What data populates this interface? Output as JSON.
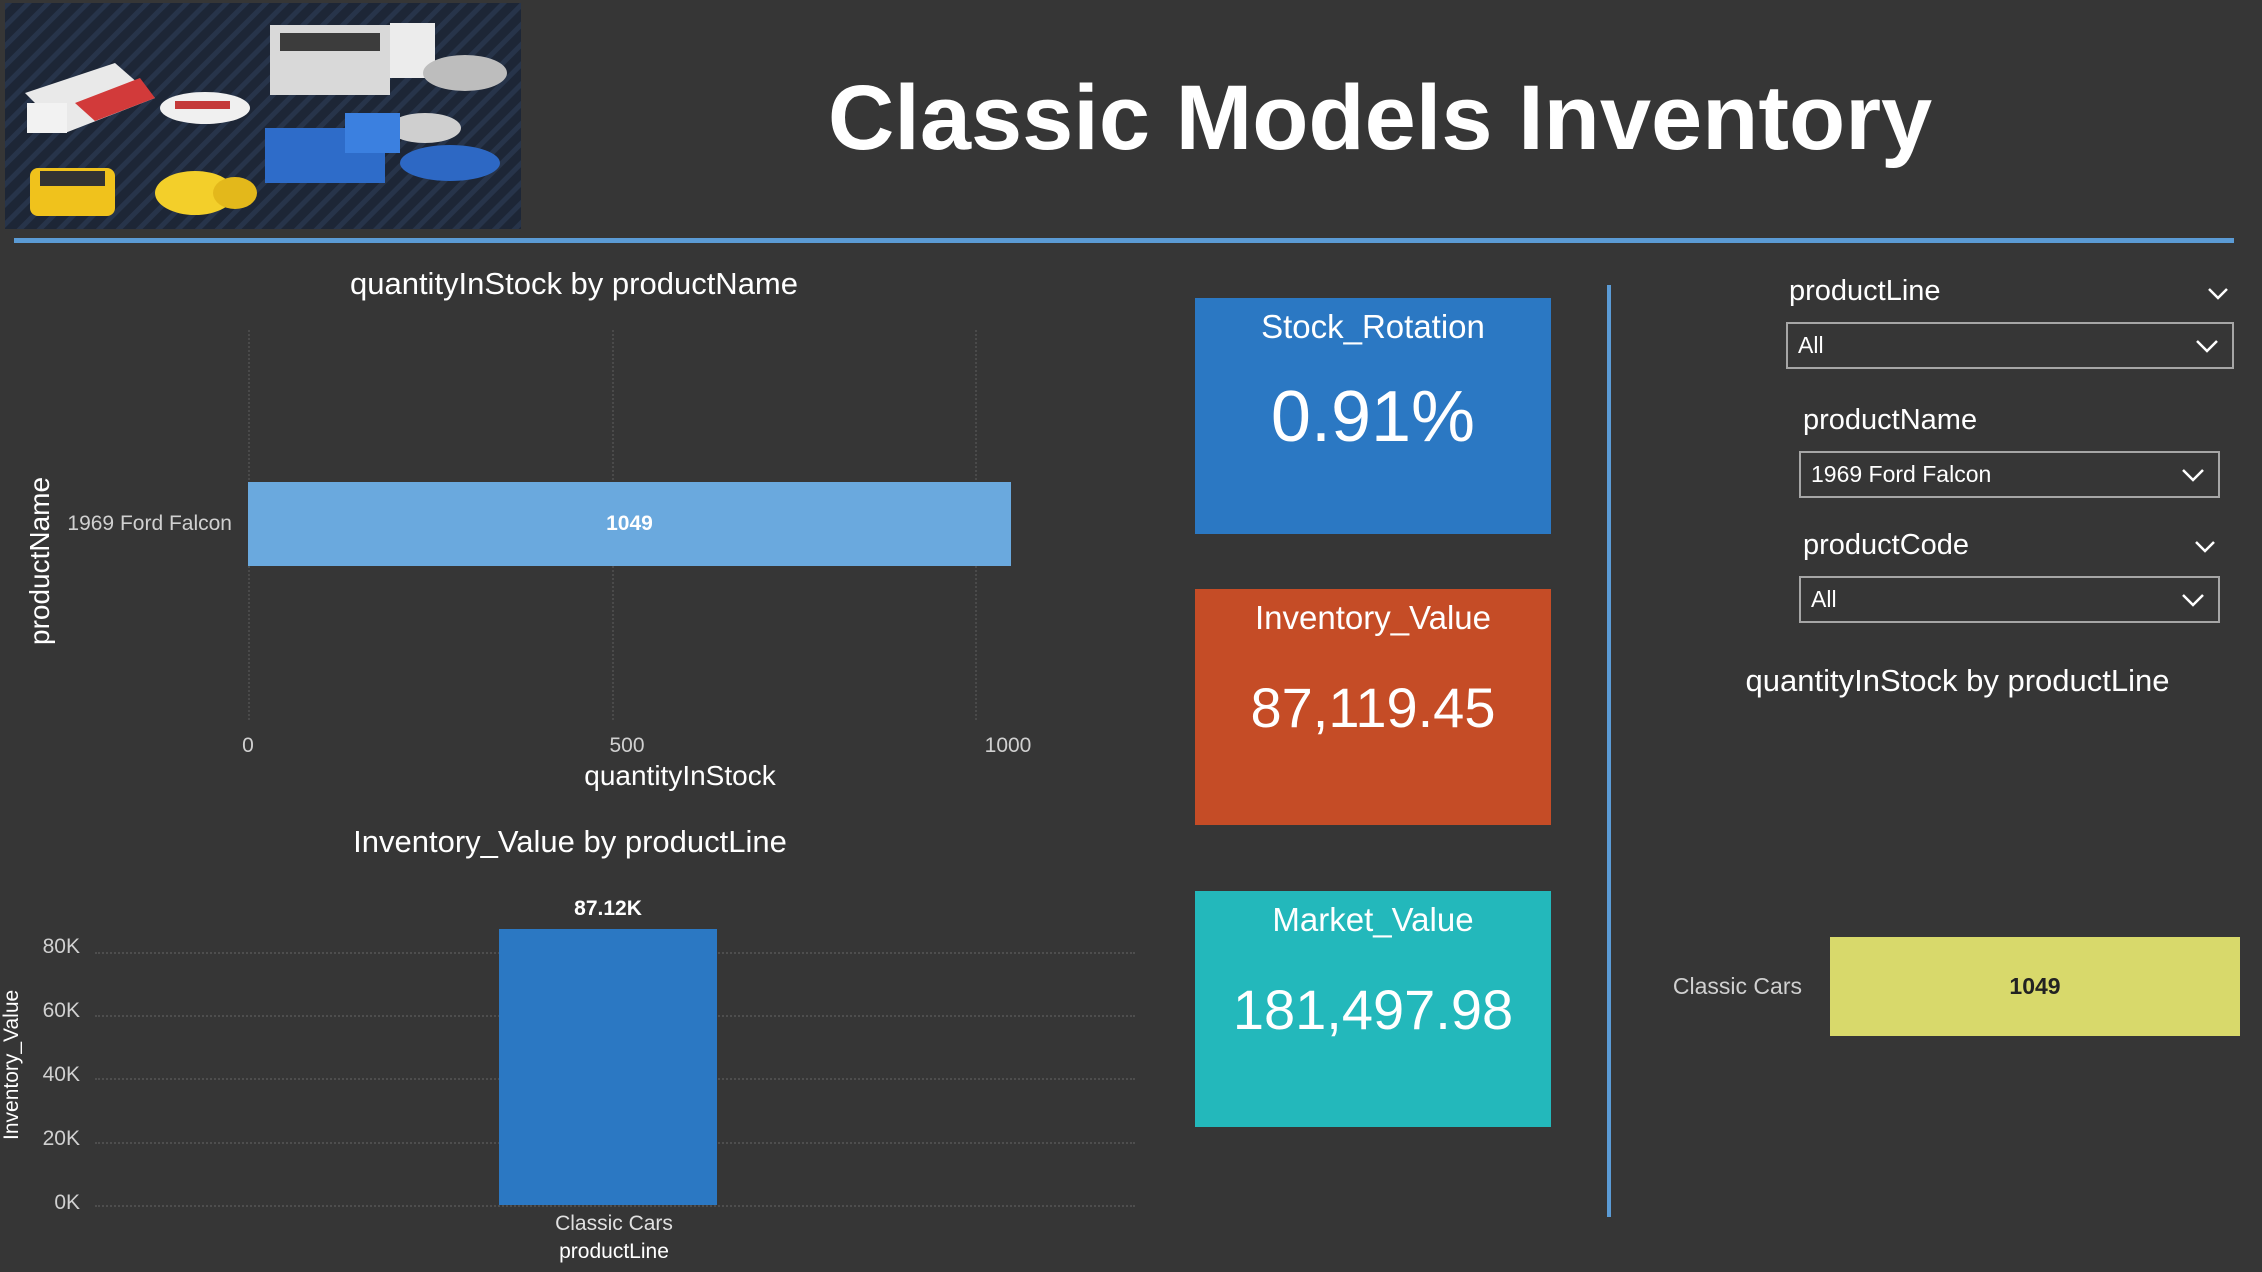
{
  "header": {
    "title": "Classic Models Inventory",
    "image_alt": "toy-cars-banner"
  },
  "chart_qty_by_name": {
    "title": "quantityInStock by productName",
    "y_axis_title": "productName",
    "x_axis_title": "quantityInStock",
    "category_label": "1969 Ford Falcon",
    "bar_label": "1049",
    "ticks": [
      "0",
      "500",
      "1000"
    ]
  },
  "chart_inv_by_line": {
    "title": "Inventory_Value by productLine",
    "y_axis_title": "Inventory_Value",
    "x_axis_title": "productLine",
    "category_label": "Classic Cars",
    "bar_label": "87.12K",
    "ticks": [
      "80K",
      "60K",
      "40K",
      "20K",
      "0K"
    ]
  },
  "cards": {
    "stock_rotation": {
      "label": "Stock_Rotation",
      "value": "0.91%"
    },
    "inventory_value": {
      "label": "Inventory_Value",
      "value": "87,119.45"
    },
    "market_value": {
      "label": "Market_Value",
      "value": "181,497.98"
    }
  },
  "slicers": {
    "product_line": {
      "label": "productLine",
      "value": "All"
    },
    "product_name": {
      "label": "productName",
      "value": "1969 Ford Falcon"
    },
    "product_code": {
      "label": "productCode",
      "value": "All"
    }
  },
  "chart_qty_by_line": {
    "title": "quantityInStock by productLine",
    "category_label": "Classic Cars",
    "bar_label": "1049"
  },
  "colors": {
    "background": "#363636",
    "accent_blue": "#2b78c3",
    "light_blue": "#6aa9de",
    "orange": "#c54c26",
    "teal": "#23b8bb",
    "yellow": "#d8d96b"
  },
  "chart_data": [
    {
      "type": "bar",
      "title": "quantityInStock by productName",
      "orientation": "horizontal",
      "categories": [
        "1969 Ford Falcon"
      ],
      "values": [
        1049
      ],
      "xlabel": "quantityInStock",
      "ylabel": "productName",
      "xlim": [
        0,
        1100
      ],
      "grid": true
    },
    {
      "type": "bar",
      "title": "Inventory_Value by productLine",
      "orientation": "vertical",
      "categories": [
        "Classic Cars"
      ],
      "values": [
        87119.45
      ],
      "xlabel": "productLine",
      "ylabel": "Inventory_Value",
      "ylim": [
        0,
        90000
      ],
      "grid": true
    },
    {
      "type": "bar",
      "title": "quantityInStock by productLine",
      "orientation": "horizontal",
      "categories": [
        "Classic Cars"
      ],
      "values": [
        1049
      ],
      "grid": false
    }
  ]
}
